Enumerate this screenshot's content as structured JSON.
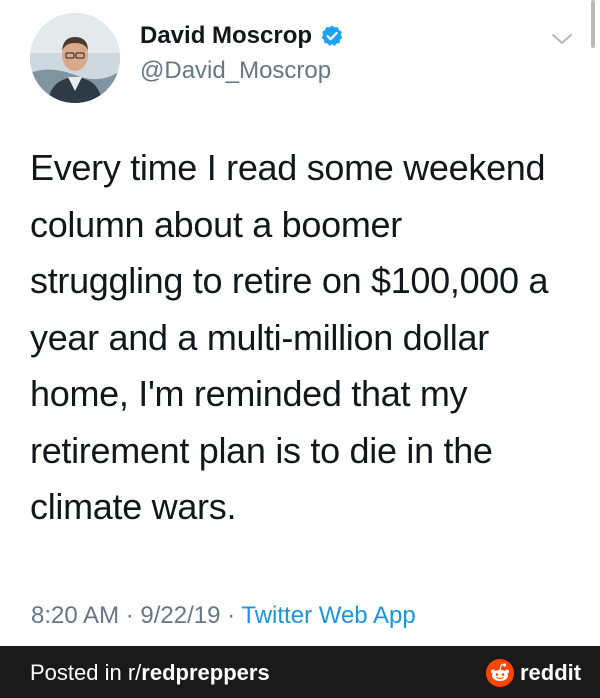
{
  "tweet": {
    "author_name": "David Moscrop",
    "handle": "@David_Moscrop",
    "text": "Every time I read some weekend\ncolumn about a boomer\nstruggling to retire on $100,000 a\nyear and a multi-million dollar\nhome, I'm reminded that my\nretirement plan is to die in the\nclimate wars.",
    "time": "8:20 AM",
    "date": "9/22/19",
    "separator": "·",
    "source": "Twitter Web App",
    "icons": {
      "avatar": "profile-photo",
      "verified": "verified-badge-icon",
      "menu": "chevron-down-icon"
    },
    "colors": {
      "verified": "#1da1f2",
      "link": "#1b95e0",
      "muted": "#657786"
    }
  },
  "footer": {
    "posted_prefix": "Posted in ",
    "subreddit_prefix": "r/",
    "subreddit": "redpreppers",
    "brand": "reddit",
    "colors": {
      "background": "#1a1a1b",
      "brand_orange": "#ff4500"
    }
  }
}
